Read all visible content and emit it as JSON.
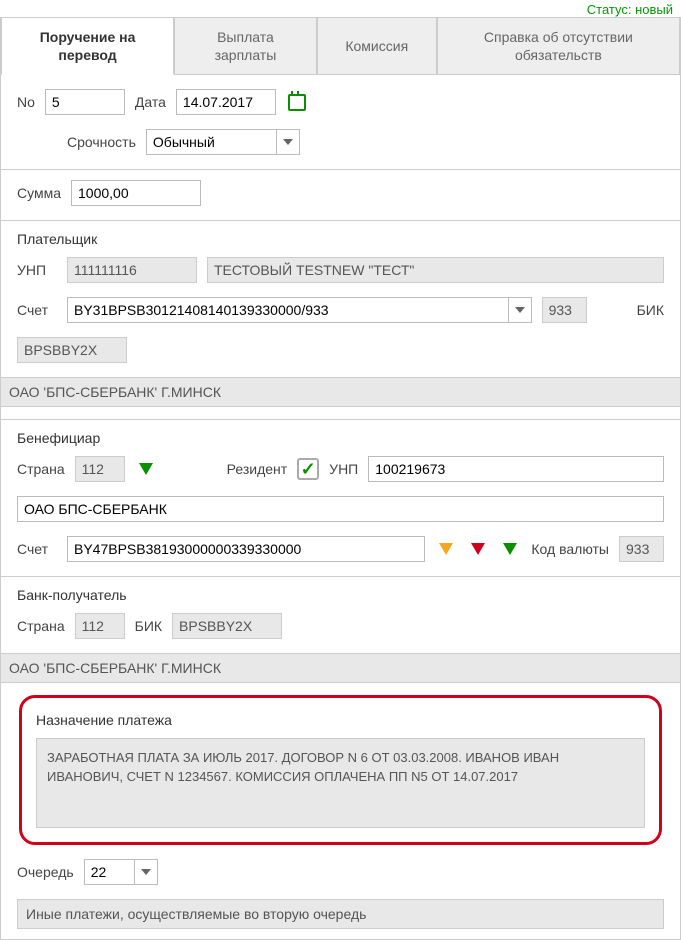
{
  "status_label": "Статус: новый",
  "tabs": {
    "t1": "Поручение на перевод",
    "t2": "Выплата зарплаты",
    "t3": "Комиссия",
    "t4": "Справка об отсутствии обязательств"
  },
  "doc": {
    "no_label": "No",
    "no_value": "5",
    "date_label": "Дата",
    "date_value": "14.07.2017",
    "urgency_label": "Срочность",
    "urgency_value": "Обычный",
    "sum_label": "Сумма",
    "sum_value": "1000,00"
  },
  "payer": {
    "title": "Плательщик",
    "unp_label": "УНП",
    "unp_value": "111111116",
    "name_value": "ТЕСТОВЫЙ TESTNEW \"ТЕСТ\"",
    "acc_label": "Счет",
    "acc_value": "BY31BPSB30121408140139330000/933",
    "bank_code": "933",
    "bic_label": "БИК",
    "bic_value": "BPSBBY2X",
    "bank_name": "ОАО 'БПС-СБЕРБАНК' Г.МИНСК"
  },
  "beneficiary": {
    "title": "Бенефициар",
    "country_label": "Страна",
    "country_value": "112",
    "resident_label": "Резидент",
    "unp_label": "УНП",
    "unp_value": "100219673",
    "name_value": "ОАО БПС-СБЕРБАНК",
    "acc_label": "Счет",
    "acc_value": "BY47BPSB38193000000339330000",
    "curr_label": "Код валюты",
    "curr_value": "933"
  },
  "recipient_bank": {
    "title": "Банк-получатель",
    "country_label": "Страна",
    "country_value": "112",
    "bic_label": "БИК",
    "bic_value": "BPSBBY2X",
    "bank_name": "ОАО 'БПС-СБЕРБАНК' Г.МИНСК"
  },
  "purpose": {
    "title": "Назначение платежа",
    "text": "ЗАРАБОТНАЯ ПЛАТА ЗА ИЮЛЬ 2017. ДОГОВОР N 6 ОТ 03.03.2008. ИВАНОВ ИВАН ИВАНОВИЧ, СЧЕТ N 1234567. КОМИССИЯ ОПЛАЧЕНА ПП N5 ОТ 14.07.2017"
  },
  "queue": {
    "label": "Очередь",
    "value": "22",
    "other_text": "Иные платежи, осуществляемые во вторую очередь"
  }
}
